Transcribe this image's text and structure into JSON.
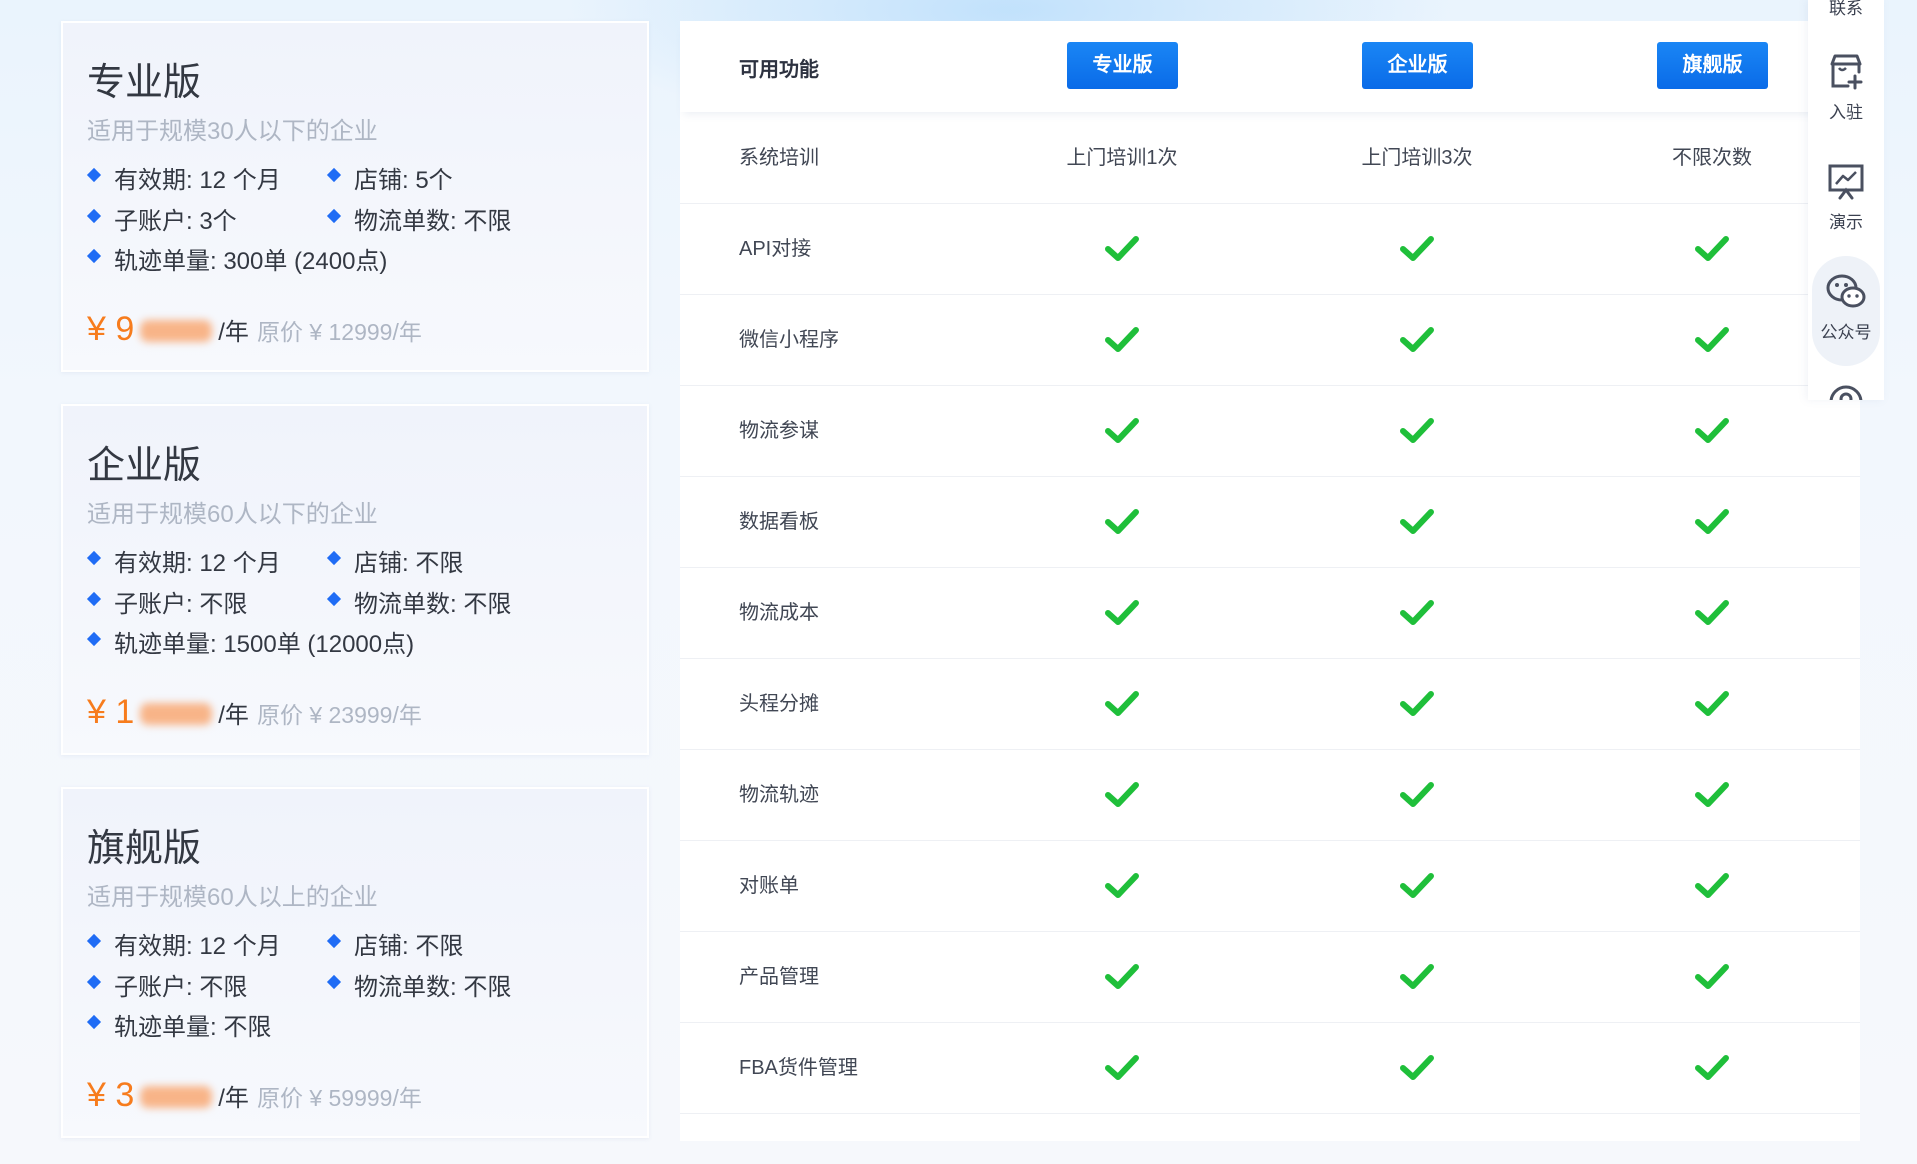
{
  "plans": [
    {
      "title": "专业版",
      "subtitle": "适用于规模30人以下的企业",
      "validity": "有效期: 12 个月",
      "stores": "店铺: 5个",
      "subaccounts": "子账户: 3个",
      "logistics_orders": "物流单数: 不限",
      "tracking": "轨迹单量: 300单 (2400点)",
      "price_prefix": "¥ 9",
      "price_unit": "/年",
      "original_price": "原价 ¥ 12999/年"
    },
    {
      "title": "企业版",
      "subtitle": "适用于规模60人以下的企业",
      "validity": "有效期: 12 个月",
      "stores": "店铺: 不限",
      "subaccounts": "子账户: 不限",
      "logistics_orders": "物流单数: 不限",
      "tracking": "轨迹单量: 1500单 (12000点)",
      "price_prefix": "¥ 1",
      "price_unit": "/年",
      "original_price": "原价 ¥ 23999/年"
    },
    {
      "title": "旗舰版",
      "subtitle": "适用于规模60人以上的企业",
      "validity": "有效期: 12 个月",
      "stores": "店铺: 不限",
      "subaccounts": "子账户: 不限",
      "logistics_orders": "物流单数: 不限",
      "tracking": "轨迹单量: 不限",
      "price_prefix": "¥ 3",
      "price_unit": "/年",
      "original_price": "原价 ¥ 59999/年"
    }
  ],
  "table": {
    "header_label": "可用功能",
    "columns": [
      "专业版",
      "企业版",
      "旗舰版"
    ],
    "rows": [
      {
        "feature": "系统培训",
        "values": [
          "上门培训1次",
          "上门培训3次",
          "不限次数"
        ]
      },
      {
        "feature": "API对接",
        "values": [
          "check",
          "check",
          "check"
        ]
      },
      {
        "feature": "微信小程序",
        "values": [
          "check",
          "check",
          "check"
        ]
      },
      {
        "feature": "物流参谋",
        "values": [
          "check",
          "check",
          "check"
        ]
      },
      {
        "feature": "数据看板",
        "values": [
          "check",
          "check",
          "check"
        ]
      },
      {
        "feature": "物流成本",
        "values": [
          "check",
          "check",
          "check"
        ]
      },
      {
        "feature": "头程分摊",
        "values": [
          "check",
          "check",
          "check"
        ]
      },
      {
        "feature": "物流轨迹",
        "values": [
          "check",
          "check",
          "check"
        ]
      },
      {
        "feature": "对账单",
        "values": [
          "check",
          "check",
          "check"
        ]
      },
      {
        "feature": "产品管理",
        "values": [
          "check",
          "check",
          "check"
        ]
      },
      {
        "feature": "FBA货件管理",
        "values": [
          "check",
          "check",
          "check"
        ]
      }
    ]
  },
  "toolbar": {
    "items": [
      {
        "label": "联系",
        "icon": "contact-icon"
      },
      {
        "label": "入驻",
        "icon": "store-plus-icon"
      },
      {
        "label": "演示",
        "icon": "presentation-icon"
      },
      {
        "label": "公众号",
        "icon": "wechat-icon"
      },
      {
        "label": "",
        "icon": "support-icon"
      }
    ]
  },
  "colors": {
    "accent_blue": "#1f6cf5",
    "price_orange": "#f77c1d",
    "check_green": "#1fbf3a"
  }
}
